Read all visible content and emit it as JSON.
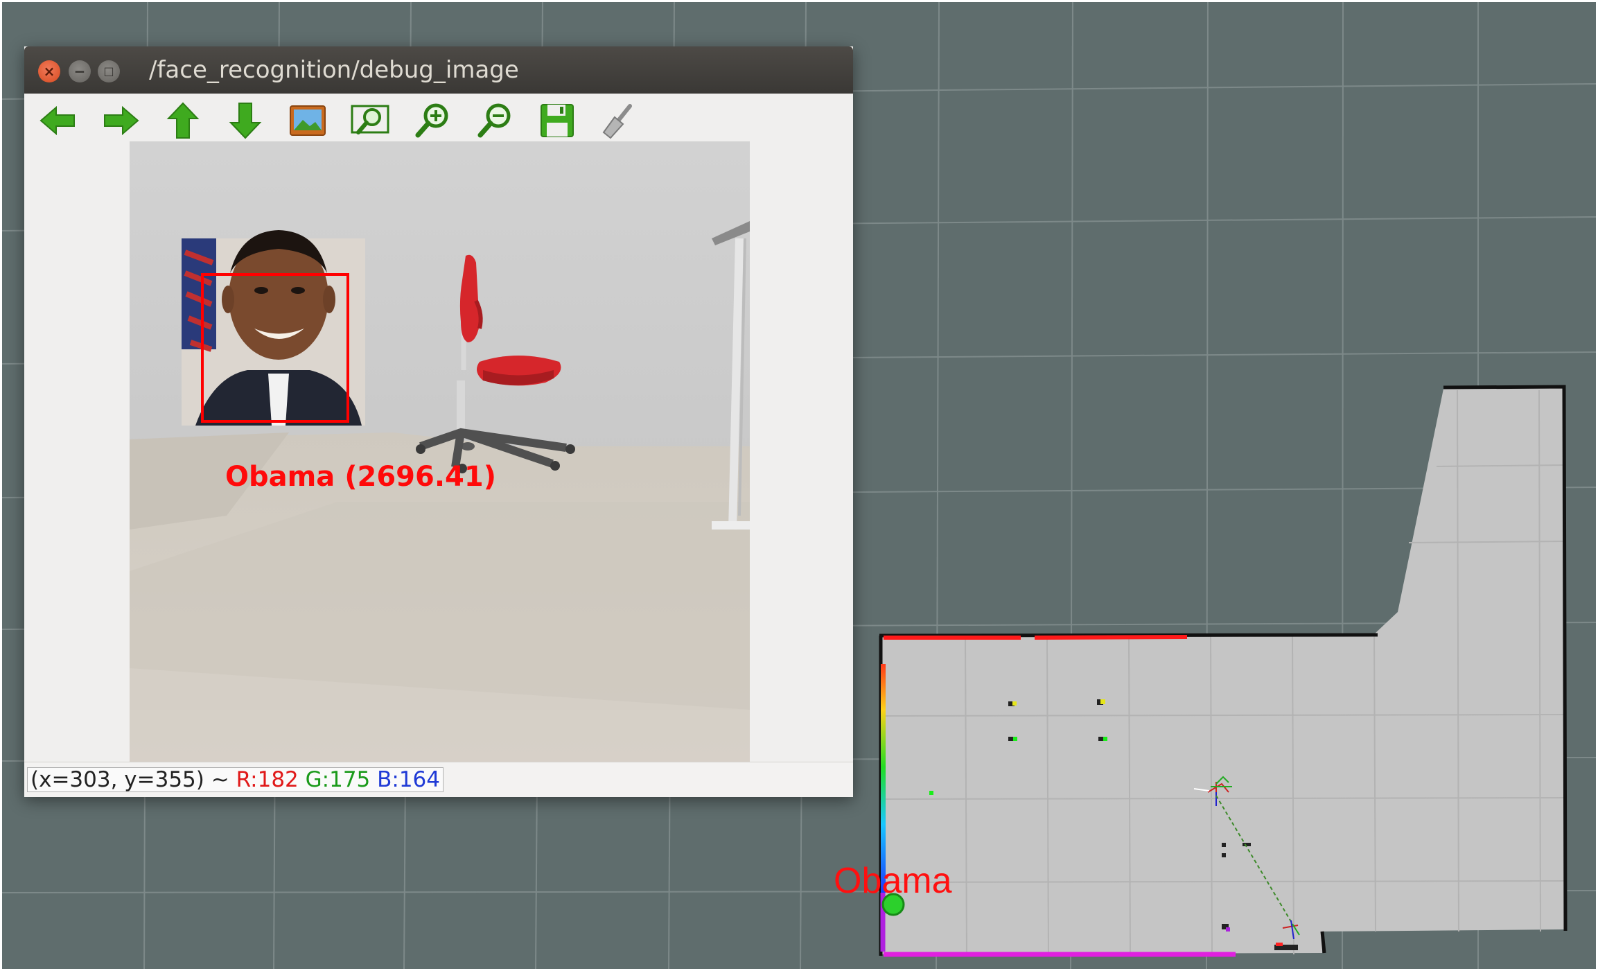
{
  "window": {
    "title": "/face_recognition/debug_image",
    "buttons": {
      "close_glyph": "×",
      "minimize_glyph": "−",
      "maximize_glyph": "□"
    }
  },
  "toolbar": {
    "icons": [
      "back-icon",
      "forward-icon",
      "up-icon",
      "down-icon",
      "image-icon",
      "zoom-fit-icon",
      "zoom-in-icon",
      "zoom-out-icon",
      "save-icon",
      "clear-icon"
    ]
  },
  "debug_image": {
    "face_label": "Obama (2696.41)"
  },
  "status": {
    "coords": "(x=303, y=355) ~ ",
    "r": "R:182",
    "g": "G:175",
    "b": "B:164"
  },
  "map": {
    "person_label": "Obama"
  },
  "colors": {
    "rviz_background": "#5f6d6d",
    "map_free": "#c4c4c4",
    "face_box": "#ff0000",
    "person_marker": "#22cc22",
    "toolbar_arrow": "#3faa1f"
  }
}
